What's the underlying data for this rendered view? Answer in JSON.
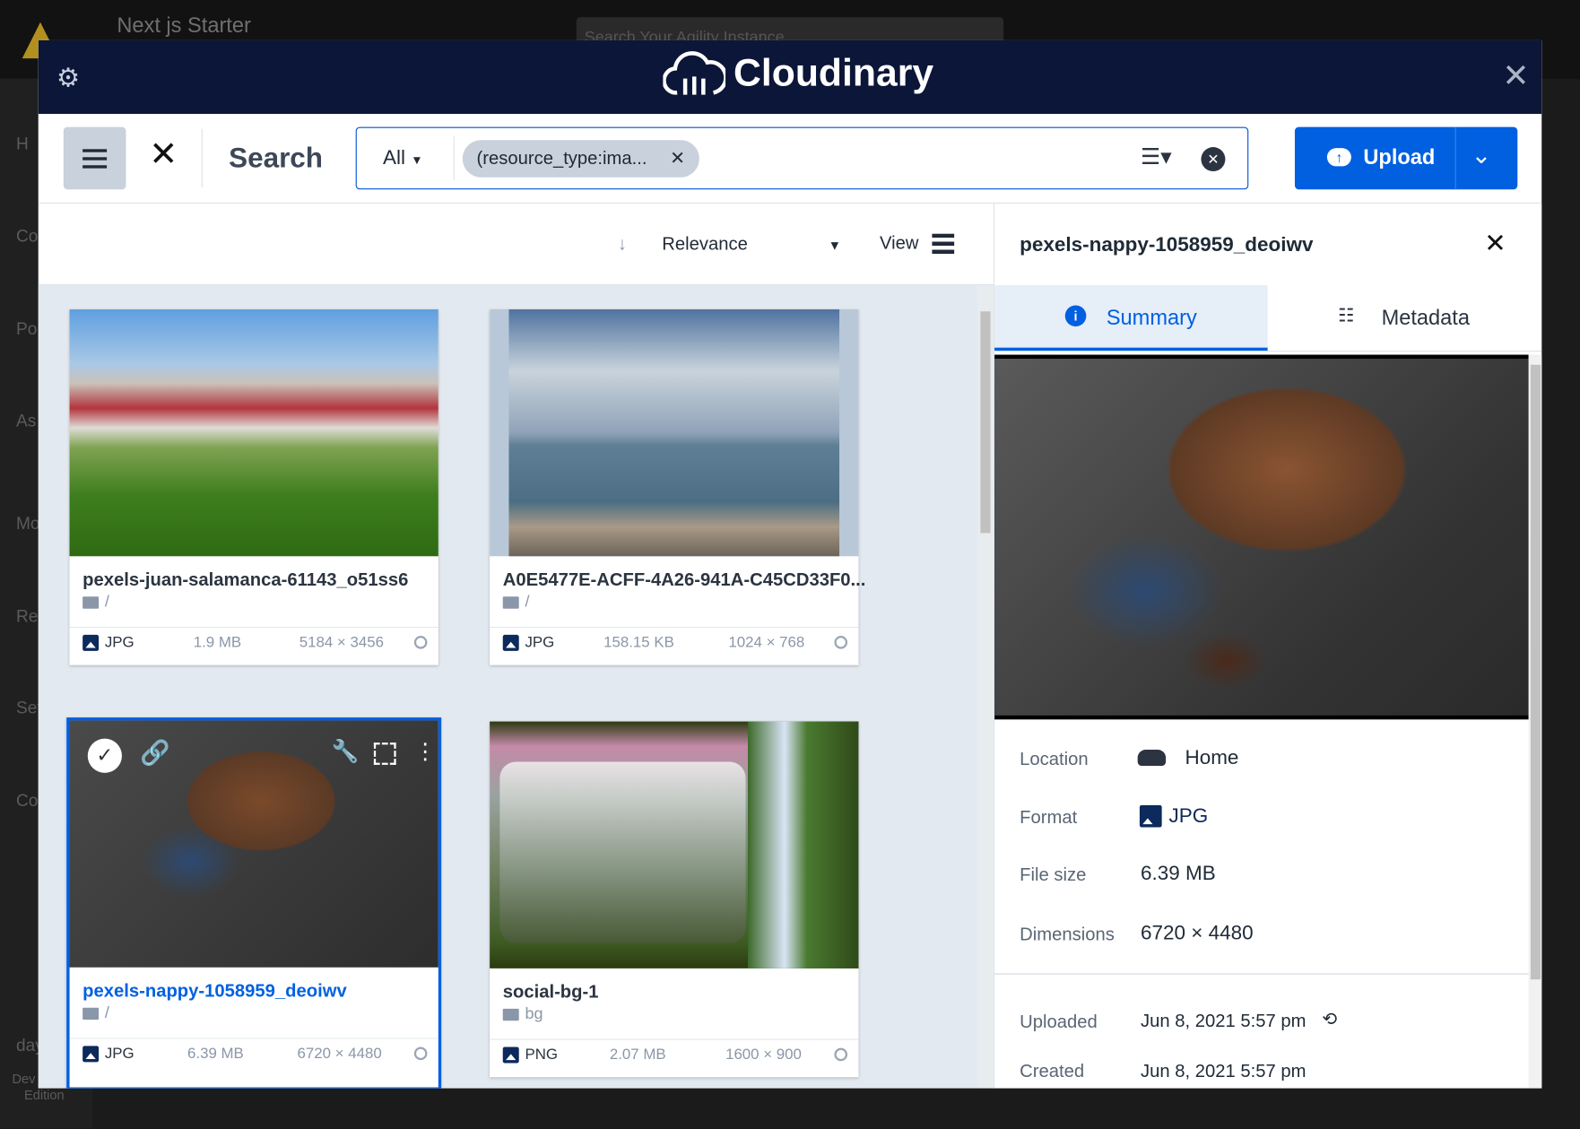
{
  "background_app": {
    "title": "Next js Starter",
    "search_placeholder": "Search Your Agility Instance",
    "sidebar_fragments": [
      "H",
      "Co",
      "Po",
      "As",
      "Mo",
      "Re",
      "Set",
      "Co",
      "day",
      "Dev",
      "Edition"
    ]
  },
  "modal": {
    "brand": "Cloudinary",
    "colors": {
      "header": "#0c1639",
      "accent": "#0060e0",
      "grid_bg": "#e3e9f0"
    }
  },
  "toolbar": {
    "search_label": "Search",
    "scope": "All",
    "chip": "(resource_type:ima...",
    "upload_label": "Upload"
  },
  "sort": {
    "label": "Relevance",
    "view_label": "View"
  },
  "assets": [
    {
      "name": "pexels-juan-salamanca-61143_o51ss6",
      "folder": "/",
      "format": "JPG",
      "size": "1.9 MB",
      "dimensions": "5184 × 3456",
      "selected": false
    },
    {
      "name": "A0E5477E-ACFF-4A26-941A-C45CD33F0...",
      "folder": "/",
      "format": "JPG",
      "size": "158.15 KB",
      "dimensions": "1024 × 768",
      "selected": false
    },
    {
      "name": "pexels-nappy-1058959_deoiwv",
      "folder": "/",
      "format": "JPG",
      "size": "6.39 MB",
      "dimensions": "6720 × 4480",
      "selected": true
    },
    {
      "name": "social-bg-1",
      "folder": "bg",
      "format": "PNG",
      "size": "2.07 MB",
      "dimensions": "1600 × 900",
      "selected": false
    }
  ],
  "details": {
    "title": "pexels-nappy-1058959_deoiwv",
    "tabs": [
      "Summary",
      "Metadata"
    ],
    "active_tab": "Summary",
    "rows": [
      {
        "label": "Location",
        "value": "Home"
      },
      {
        "label": "Format",
        "value": "JPG"
      },
      {
        "label": "File size",
        "value": "6.39 MB"
      },
      {
        "label": "Dimensions",
        "value": "6720 × 4480"
      },
      {
        "label": "Uploaded",
        "value": "Jun 8, 2021 5:57 pm"
      },
      {
        "label": "Created",
        "value": "Jun 8, 2021 5:57 pm"
      }
    ]
  }
}
